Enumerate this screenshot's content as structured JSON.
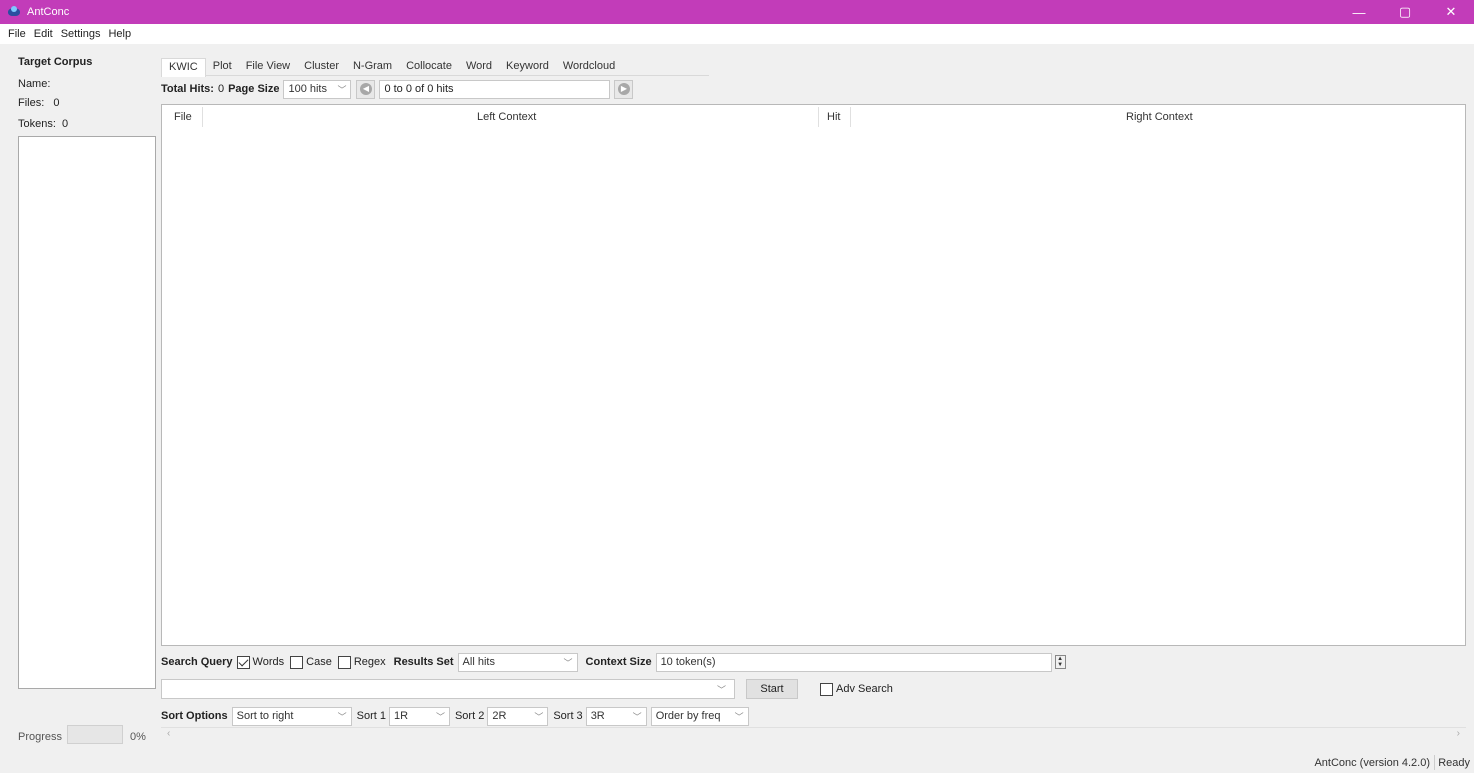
{
  "window": {
    "title": "AntConc",
    "minimize": "—",
    "maximize": "▢",
    "close": "✕"
  },
  "menu": [
    "File",
    "Edit",
    "Settings",
    "Help"
  ],
  "target_corpus": {
    "title": "Target Corpus",
    "name_label": "Name:",
    "files_label": "Files:",
    "files_value": "0",
    "tokens_label": "Tokens:",
    "tokens_value": "0"
  },
  "progress": {
    "label": "Progress",
    "percent_text": "0%",
    "value": 0
  },
  "tabs": [
    "KWIC",
    "Plot",
    "File View",
    "Cluster",
    "N-Gram",
    "Collocate",
    "Word",
    "Keyword",
    "Wordcloud"
  ],
  "active_tab": "KWIC",
  "kwic_toolbar": {
    "total_hits_label": "Total Hits:",
    "total_hits_value": "0",
    "page_size_label": "Page Size",
    "page_size_value": "100 hits",
    "hits_range": "0 to 0 of 0 hits"
  },
  "results_table": {
    "columns": [
      "File",
      "Left Context",
      "Hit",
      "Right Context"
    ],
    "rows": []
  },
  "search_options": {
    "search_query_label": "Search Query",
    "words_label": "Words",
    "words_checked": true,
    "case_label": "Case",
    "case_checked": false,
    "regex_label": "Regex",
    "regex_checked": false,
    "results_set_label": "Results Set",
    "results_set_value": "All hits",
    "context_size_label": "Context Size",
    "context_size_value": "10 token(s)"
  },
  "query": {
    "value": "",
    "start_label": "Start",
    "adv_search_label": "Adv Search",
    "adv_search_checked": false
  },
  "sort_options": {
    "label": "Sort Options",
    "sort_mode": "Sort to right",
    "sort1_label": "Sort 1",
    "sort1_value": "1R",
    "sort2_label": "Sort 2",
    "sort2_value": "2R",
    "sort3_label": "Sort 3",
    "sort3_value": "3R",
    "order_value": "Order by freq"
  },
  "status": {
    "version": "AntConc (version 4.2.0)",
    "state": "Ready"
  }
}
